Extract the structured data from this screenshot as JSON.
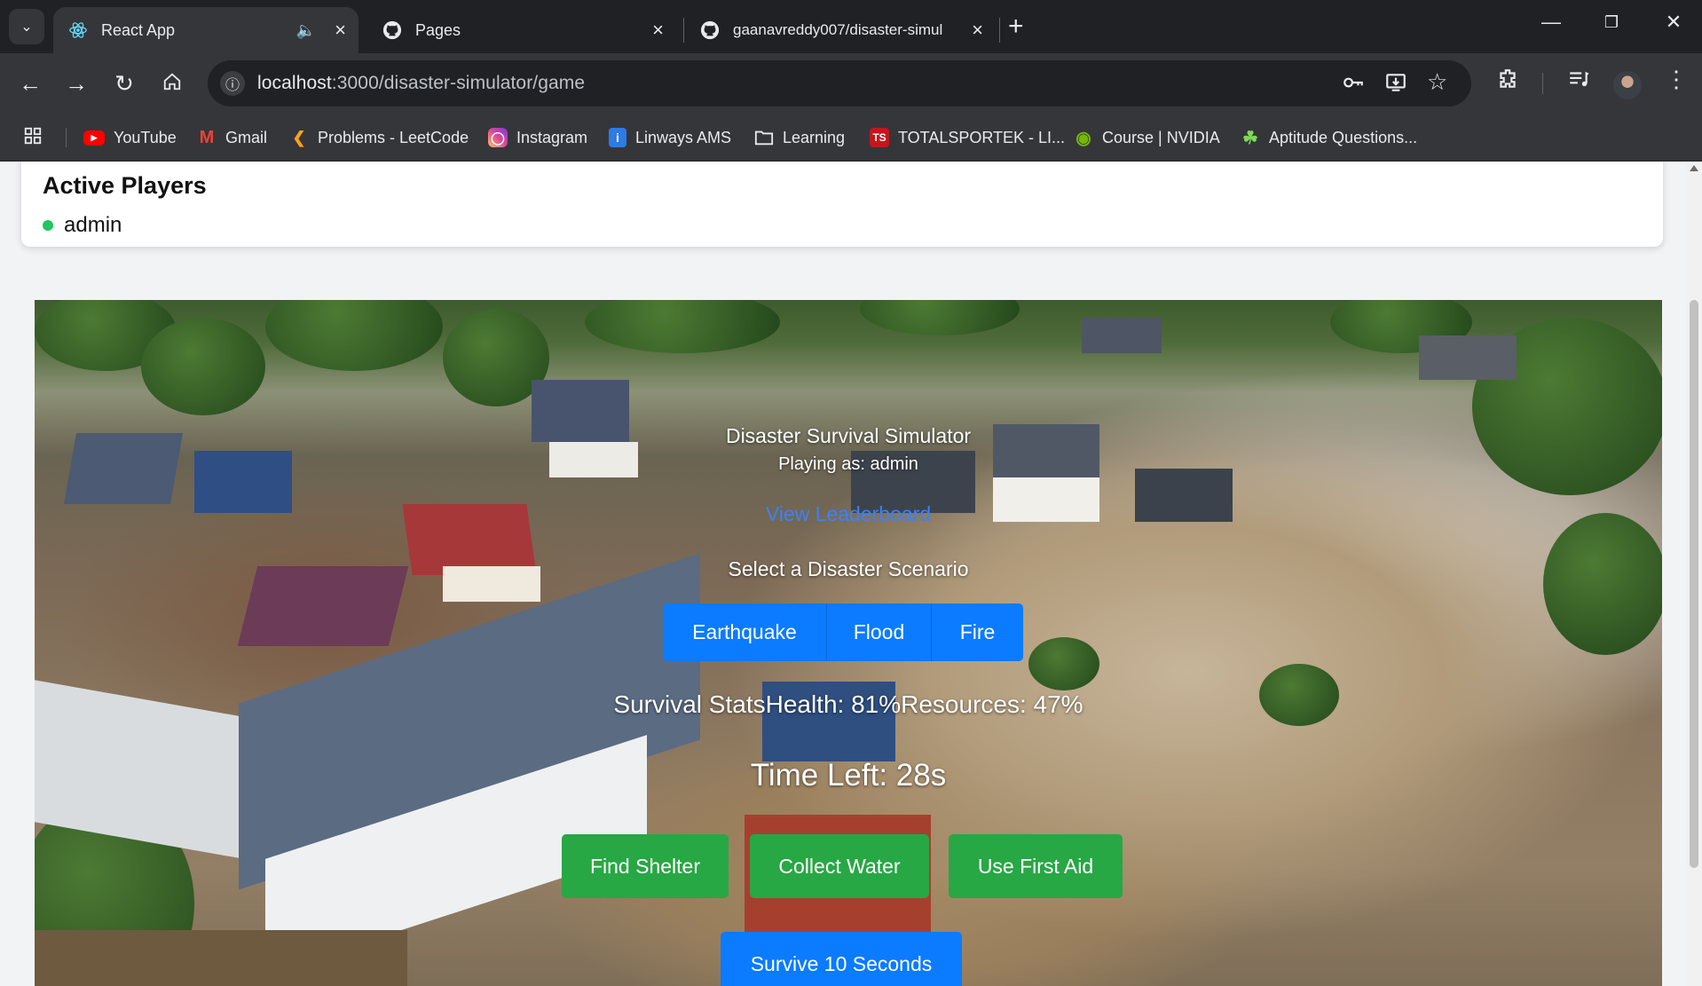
{
  "browser": {
    "tabs": [
      {
        "title": "React App",
        "active": true,
        "icon": "react-icon"
      },
      {
        "title": "Pages",
        "active": false,
        "icon": "github-icon"
      },
      {
        "title": "gaanavreddy007/disaster-simul",
        "active": false,
        "icon": "github-icon"
      }
    ],
    "url": {
      "host": "localhost",
      "path": ":3000/disaster-simulator/game"
    },
    "bookmarks": [
      {
        "label": "YouTube",
        "icon": "youtube-icon"
      },
      {
        "label": "Gmail",
        "icon": "gmail-icon"
      },
      {
        "label": "Problems - LeetCode",
        "icon": "leetcode-icon"
      },
      {
        "label": "Instagram",
        "icon": "instagram-icon"
      },
      {
        "label": "Linways AMS",
        "icon": "linways-icon"
      },
      {
        "label": "Learning",
        "icon": "folder-icon"
      },
      {
        "label": "TOTALSPORTEK - LI...",
        "icon": "totalsportek-icon"
      },
      {
        "label": "Course | NVIDIA",
        "icon": "nvidia-icon"
      },
      {
        "label": "Aptitude Questions...",
        "icon": "aptitude-icon"
      }
    ],
    "colors": {
      "chrome_dark": "#202124",
      "chrome_toolbar": "#35363a"
    }
  },
  "players": {
    "title": "Active Players",
    "list": [
      {
        "name": "admin",
        "status_color": "#22c55e"
      }
    ]
  },
  "game": {
    "title": "Disaster Survival Simulator",
    "playing_as": "Playing as: admin",
    "leaderboard_link": "View Leaderboard",
    "scenario_label": "Select a Disaster Scenario",
    "scenarios": [
      "Earthquake",
      "Flood",
      "Fire"
    ],
    "stats_line": "Survival StatsHealth: 81%Resources: 47%",
    "time_left": "Time Left: 28s",
    "actions": [
      "Find Shelter",
      "Collect Water",
      "Use First Aid"
    ],
    "survive_button": "Survive 10 Seconds",
    "colors": {
      "primary": "#0b7bff",
      "success": "#28a745",
      "link": "#3b82f6"
    }
  }
}
